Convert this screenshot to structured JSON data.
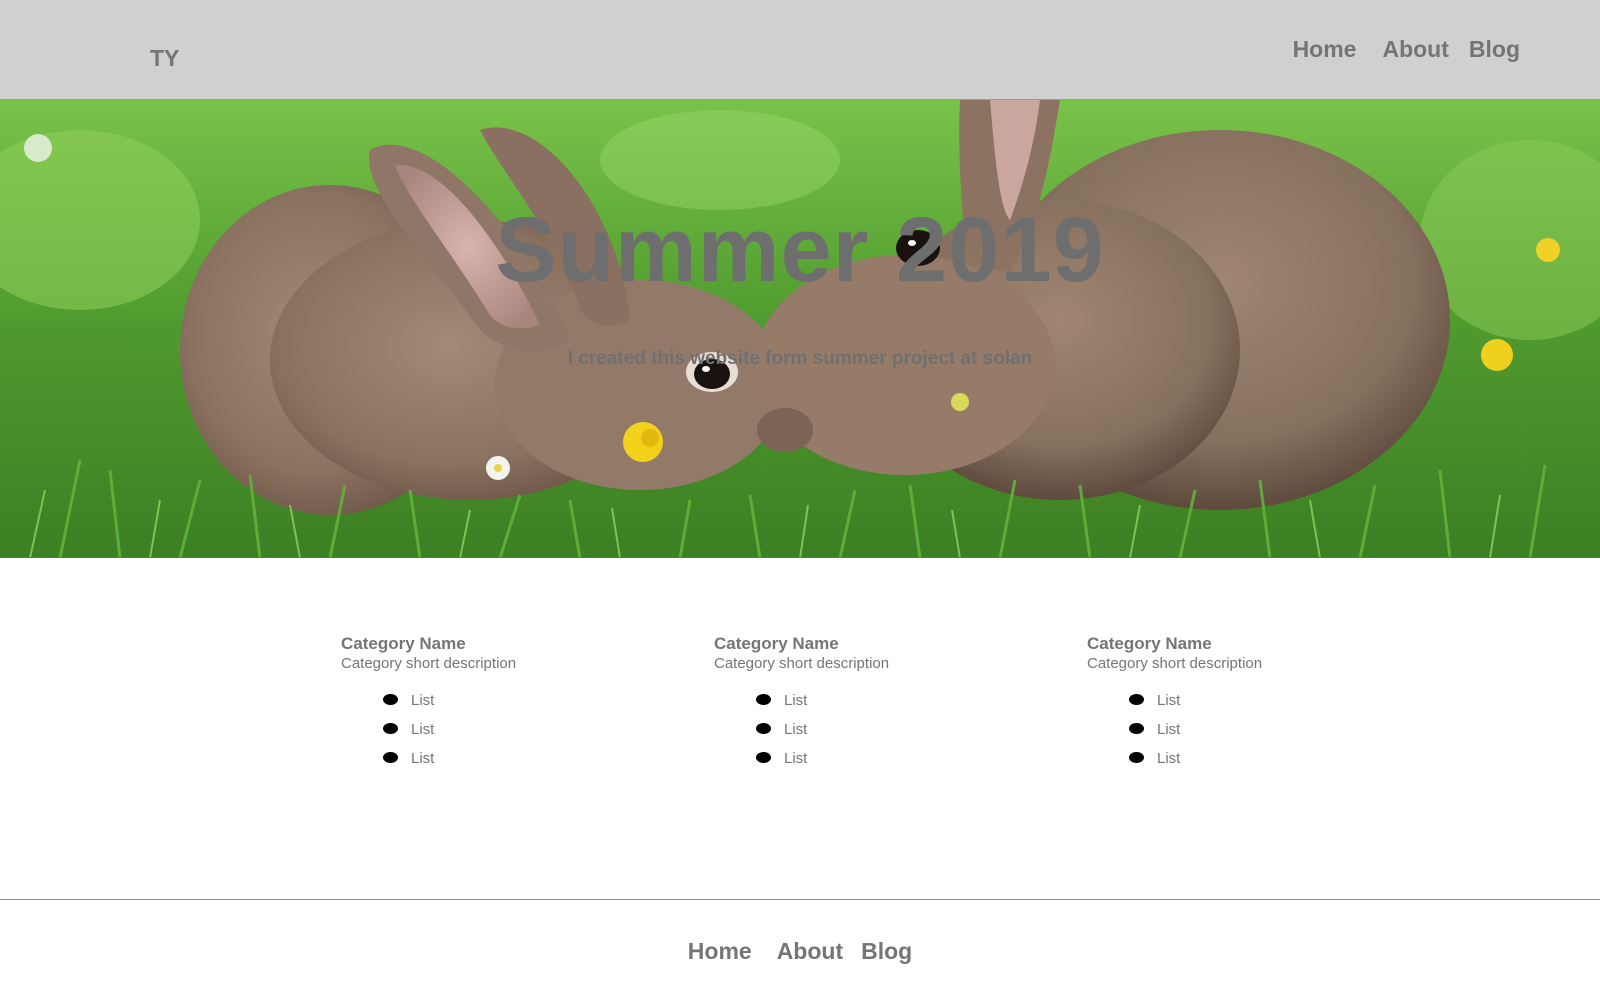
{
  "header": {
    "logo": "TY",
    "nav": [
      "Home",
      "About",
      "Blog"
    ]
  },
  "hero": {
    "title": "Summer 2019",
    "subtitle": "I created this website form summer project at solan",
    "image": "two-rabbits-in-grass-photo"
  },
  "categories": [
    {
      "title": "Category Name",
      "description": "Category short description",
      "items": [
        "List",
        "List",
        "List"
      ]
    },
    {
      "title": "Category Name",
      "description": "Category short description",
      "items": [
        "List",
        "List",
        "List"
      ]
    },
    {
      "title": "Category Name",
      "description": "Category short description",
      "items": [
        "List",
        "List",
        "List"
      ]
    }
  ],
  "footer": {
    "nav": [
      "Home",
      "About",
      "Blog"
    ]
  },
  "colors": {
    "header_bg": "#d0d0d0",
    "text": "#757575",
    "grass": "#4f9a2e",
    "bullet": "#000000"
  }
}
